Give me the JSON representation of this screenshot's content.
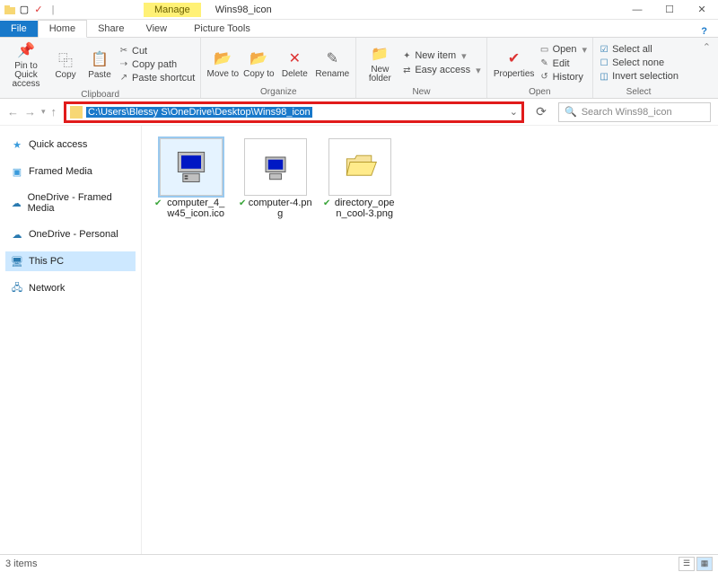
{
  "titlebar": {
    "manage": "Manage",
    "title": "Wins98_icon"
  },
  "tabs": {
    "file": "File",
    "home": "Home",
    "share": "Share",
    "view": "View",
    "ptools": "Picture Tools"
  },
  "ribbon": {
    "clipboard": {
      "name": "Clipboard",
      "pin": "Pin to Quick access",
      "copy": "Copy",
      "paste": "Paste",
      "cut": "Cut",
      "copypath": "Copy path",
      "pasteshort": "Paste shortcut"
    },
    "organize": {
      "name": "Organize",
      "moveto": "Move to",
      "copyto": "Copy to",
      "delete": "Delete",
      "rename": "Rename"
    },
    "new": {
      "name": "New",
      "newfolder": "New folder",
      "newitem": "New item",
      "easyaccess": "Easy access"
    },
    "open": {
      "name": "Open",
      "properties": "Properties",
      "open": "Open",
      "edit": "Edit",
      "history": "History"
    },
    "select": {
      "name": "Select",
      "selectall": "Select all",
      "selectnone": "Select none",
      "invert": "Invert selection"
    }
  },
  "addr": {
    "path": "C:\\Users\\Blessy S\\OneDrive\\Desktop\\Wins98_icon",
    "search_ph": "Search Wins98_icon"
  },
  "nav": {
    "quick": "Quick access",
    "framed": "Framed Media",
    "od1": "OneDrive - Framed Media",
    "od2": "OneDrive - Personal",
    "thispc": "This PC",
    "network": "Network"
  },
  "files": [
    {
      "name": "computer_4_w45_icon.ico",
      "type": "computer"
    },
    {
      "name": "computer-4.png",
      "type": "computer"
    },
    {
      "name": "directory_open_cool-3.png",
      "type": "folder"
    }
  ],
  "status": {
    "count": "3 items"
  }
}
